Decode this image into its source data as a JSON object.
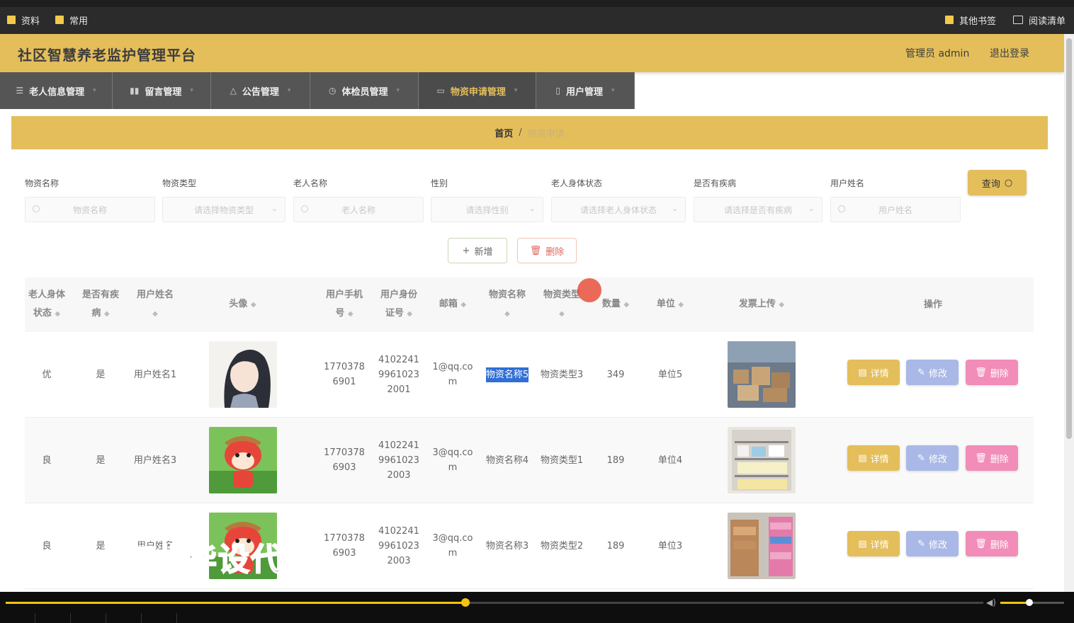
{
  "bookmarks": {
    "left": [
      {
        "label": "资料"
      },
      {
        "label": "常用"
      }
    ],
    "right": [
      {
        "label": "其他书签"
      },
      {
        "label": "阅读清单"
      }
    ]
  },
  "header": {
    "title": "社区智慧养老监护管理平台",
    "user": "管理员 admin",
    "logout": "退出登录"
  },
  "nav": [
    {
      "label": "老人信息管理",
      "icon": "menu-icon"
    },
    {
      "label": "留言管理",
      "icon": "bar-chart-icon"
    },
    {
      "label": "公告管理",
      "icon": "bell-icon"
    },
    {
      "label": "体检员管理",
      "icon": "clock-icon"
    },
    {
      "label": "物资申请管理",
      "icon": "card-icon",
      "active": true
    },
    {
      "label": "用户管理",
      "icon": "phone-icon"
    }
  ],
  "breadcrumb": {
    "home": "首页",
    "separator": "/",
    "current": "物资申请"
  },
  "filters": [
    {
      "label": "物资名称",
      "placeholder": "物资名称",
      "type": "input"
    },
    {
      "label": "物资类型",
      "placeholder": "请选择物资类型",
      "type": "select"
    },
    {
      "label": "老人名称",
      "placeholder": "老人名称",
      "type": "input"
    },
    {
      "label": "性别",
      "placeholder": "请选择性别",
      "type": "select"
    },
    {
      "label": "老人身体状态",
      "placeholder": "请选择老人身体状态",
      "type": "select"
    },
    {
      "label": "是否有疾病",
      "placeholder": "请选择是否有疾病",
      "type": "select"
    },
    {
      "label": "用户姓名",
      "placeholder": "用户姓名",
      "type": "input"
    }
  ],
  "buttons": {
    "query": "查询",
    "add": "新增",
    "delete": "删除"
  },
  "table": {
    "columns": [
      "老人身体状态",
      "是否有疾病",
      "用户姓名",
      "头像",
      "用户手机号",
      "用户身份证号",
      "邮箱",
      "物资名称",
      "物资类型",
      "数量",
      "单位",
      "发票上传",
      "操作"
    ],
    "rows": [
      {
        "status": "优",
        "disease": "是",
        "username": "用户姓名1",
        "phone": "17703786901",
        "idcard": "410224199610232001",
        "email": "1@qq.com",
        "material": "物资名称5",
        "mtype": "物资类型3",
        "qty": "349",
        "unit": "单位5"
      },
      {
        "status": "良",
        "disease": "是",
        "username": "用户姓名3",
        "phone": "17703786903",
        "idcard": "410224199610232003",
        "email": "3@qq.com",
        "material": "物资名称4",
        "mtype": "物资类型1",
        "qty": "189",
        "unit": "单位4"
      },
      {
        "status": "良",
        "disease": "是",
        "username": "用户姓名",
        "phone": "17703786903",
        "idcard": "410224199610232003",
        "email": "3@qq.com",
        "material": "物资名称3",
        "mtype": "物资类型2",
        "qty": "189",
        "unit": "单位3"
      }
    ],
    "actions": {
      "detail": "详情",
      "edit": "修改",
      "remove": "删除"
    }
  },
  "watermark": "专业毕设代做",
  "colors": {
    "brand": "#e4be5a",
    "nav_bg": "#555555",
    "edit": "#a9b8e6",
    "remove": "#f28cb8"
  },
  "video": {
    "progress": 0.47,
    "volume": 0.45
  }
}
